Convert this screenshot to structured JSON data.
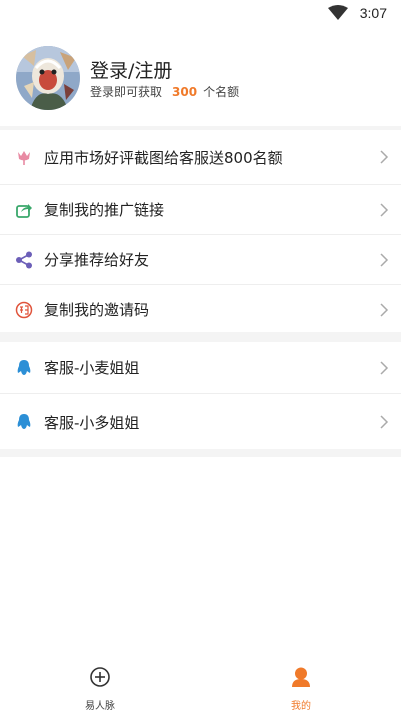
{
  "status_bar": {
    "time": "3:07"
  },
  "profile": {
    "title": "登录/注册",
    "subtitle_prefix": "登录即可获取",
    "quota": "300",
    "subtitle_suffix": "个名额"
  },
  "menu_group_1": [
    {
      "label": "应用市场好评截图给客服送800名额",
      "icon": "tulip-icon"
    },
    {
      "label": "复制我的推广链接",
      "icon": "share-arrow-icon"
    },
    {
      "label": "分享推荐给好友",
      "icon": "share-nodes-icon"
    },
    {
      "label": "复制我的邀请码",
      "icon": "invite-seal-icon"
    }
  ],
  "menu_group_2": [
    {
      "label": "客服-小麦姐姐",
      "icon": "qq-penguin-icon"
    },
    {
      "label": "客服-小多姐姐",
      "icon": "qq-penguin-icon"
    }
  ],
  "tabbar": {
    "tabs": [
      {
        "label": "易人脉",
        "icon": "plus-circle-icon",
        "active": false
      },
      {
        "label": "我的",
        "icon": "person-icon",
        "active": true
      }
    ]
  },
  "colors": {
    "accent": "#f07a2a",
    "tulip": "#e88aa3",
    "share_green": "#3aa86b",
    "share_purple": "#6c5fb8",
    "invite_red": "#e0543c",
    "qq_blue": "#2c8fd6",
    "separator": "#f4f4f4"
  }
}
